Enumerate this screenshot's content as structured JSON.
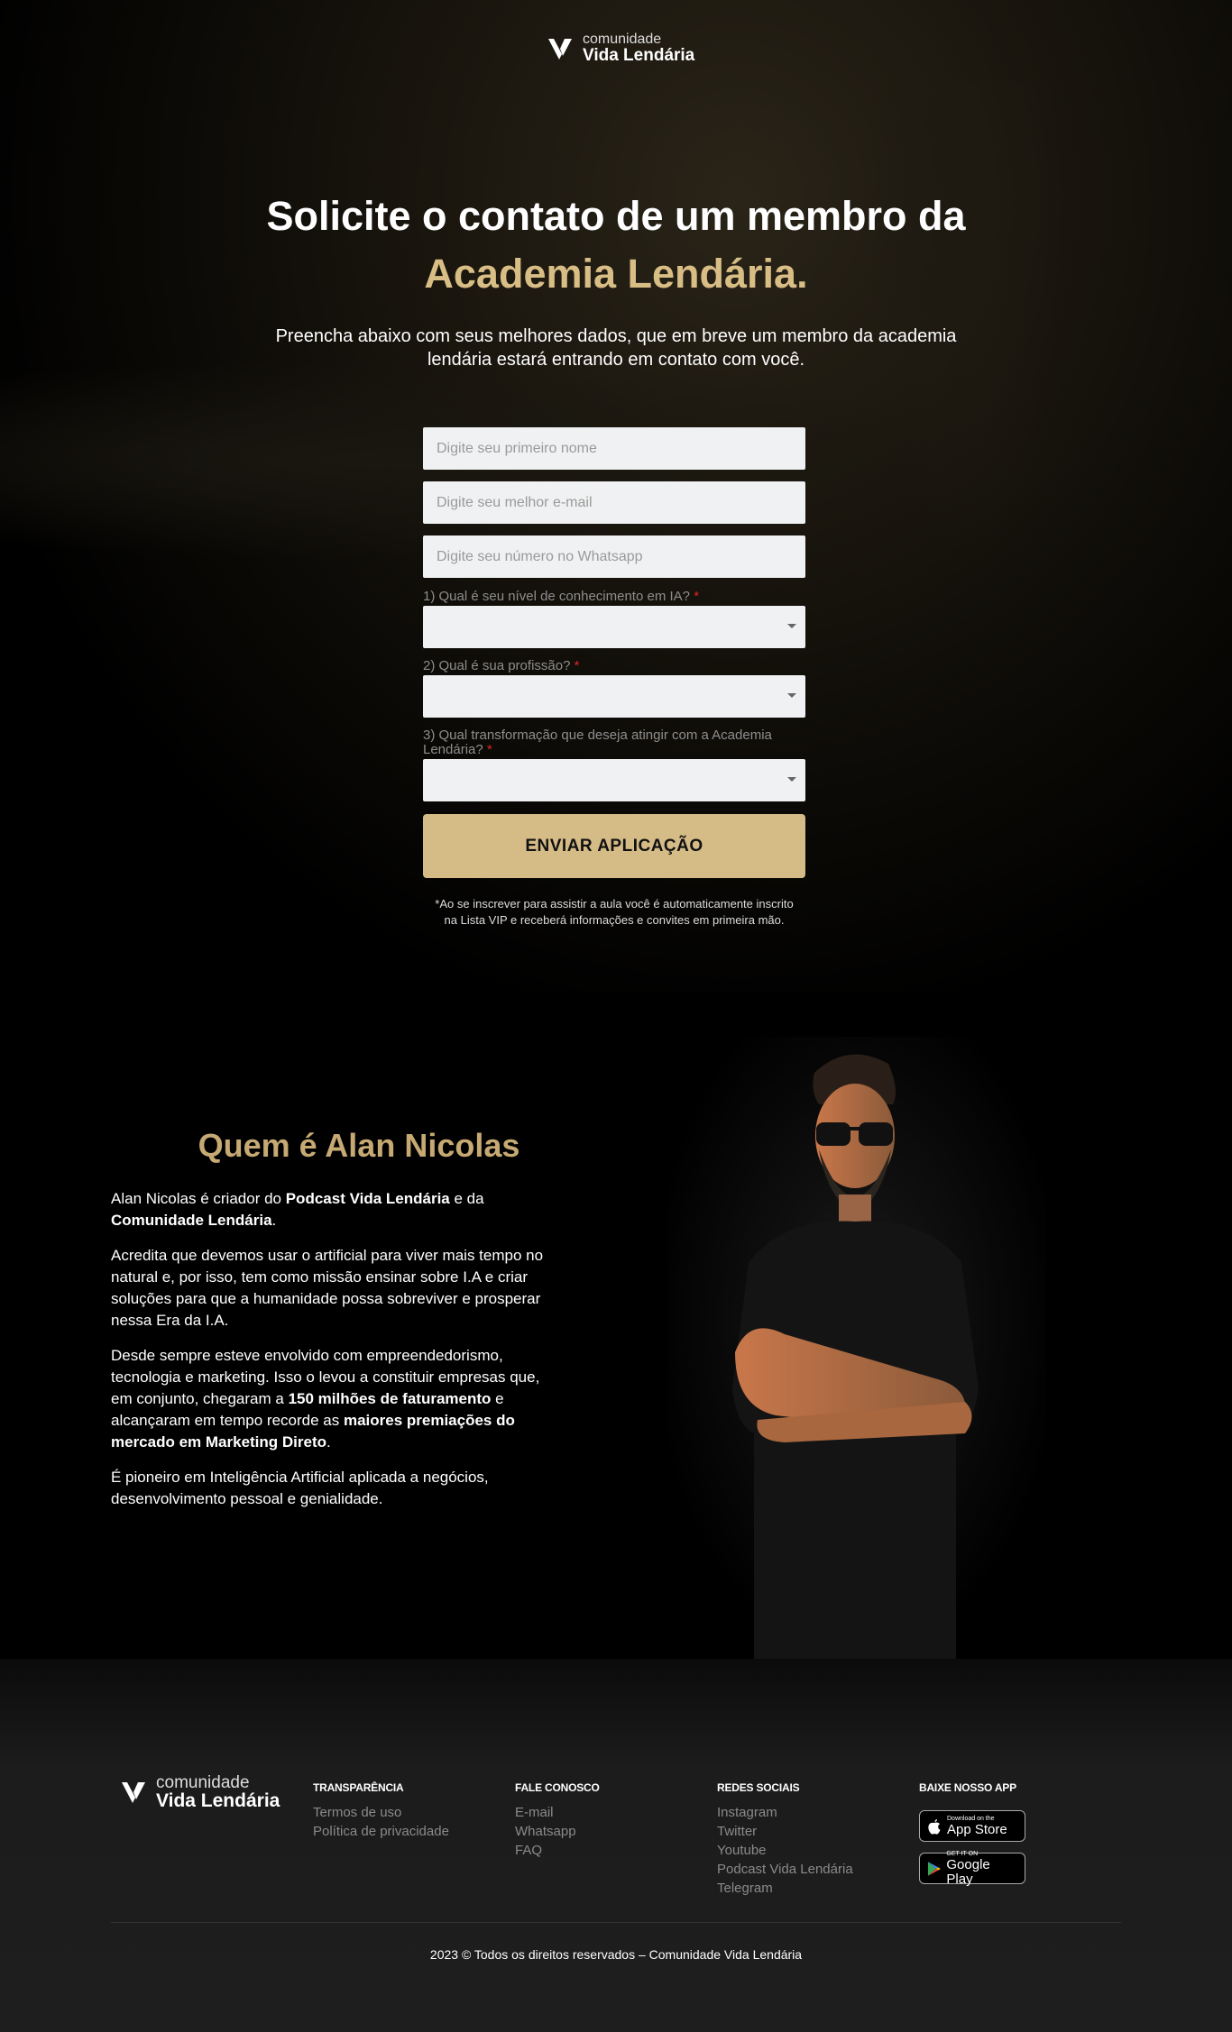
{
  "brand": {
    "logo_top": "comunidade",
    "logo_bottom": "Vida Lendária",
    "accent_color": "#d5bb86"
  },
  "hero": {
    "title_line1": "Solicite o contato de um membro da",
    "title_line2": "Academia Lendária.",
    "subtitle": "Preencha abaixo com seus melhores dados, que em breve um membro da academia lendária estará entrando em contato com você."
  },
  "form": {
    "name_placeholder": "Digite seu primeiro nome",
    "email_placeholder": "Digite seu melhor e-mail",
    "whatsapp_placeholder": "Digite seu número no Whatsapp",
    "questions": [
      {
        "label": "1) Qual é seu nível de conhecimento em IA?",
        "required_mark": "*",
        "value": ""
      },
      {
        "label": "2) Qual é sua profissão?",
        "required_mark": "*",
        "value": ""
      },
      {
        "label": "3) Qual transformação que deseja atingir com a Academia Lendária?",
        "required_mark": "*",
        "value": ""
      }
    ],
    "submit_label": "ENVIAR APLICAÇÃO",
    "disclaimer": "*Ao se inscrever para assistir a aula você é automaticamente inscrito na Lista VIP e receberá informações e convites em primeira mão."
  },
  "about": {
    "title": "Quem é Alan Nicolas",
    "p1_a": "Alan Nicolas é criador do ",
    "p1_b": "Podcast Vida Lendária",
    "p1_c": " e da ",
    "p1_d": "Comunidade Lendária",
    "p1_e": ".",
    "p2": "Acredita que devemos usar o artificial para viver mais tempo no natural e, por isso, tem como missão ensinar sobre I.A e criar soluções para que a humanidade possa sobreviver e prosperar nessa Era da I.A.",
    "p3_a": "Desde sempre esteve envolvido com empreendedorismo, tecnologia e marketing. Isso o levou a constituir empresas que, em conjunto, chegaram a ",
    "p3_b": "150 milhões de faturamento",
    "p3_c": " e alcançaram em tempo recorde as ",
    "p3_d": "maiores premiações do mercado em Marketing Direto",
    "p3_e": ".",
    "p4": "É pioneiro em Inteligência Artificial aplicada a negócios, desenvolvimento pessoal e genialidade."
  },
  "footer": {
    "columns": [
      {
        "heading": "TRANSPARÊNCIA",
        "links": [
          "Termos de uso",
          "Política de privacidade"
        ]
      },
      {
        "heading": "FALE CONOSCO",
        "links": [
          "E-mail",
          "Whatsapp",
          "FAQ"
        ]
      },
      {
        "heading": "REDES SOCIAIS",
        "links": [
          "Instagram",
          "Twitter",
          "Youtube",
          "Podcast Vida Lendária",
          "Telegram"
        ]
      }
    ],
    "app_heading": "BAIXE NOSSO APP",
    "app_store_small": "Download on the",
    "app_store_big": "App Store",
    "google_play_small": "GET IT ON",
    "google_play_big": "Google Play",
    "copyright": "2023 © Todos os direitos reservados – Comunidade Vida Lendária"
  }
}
